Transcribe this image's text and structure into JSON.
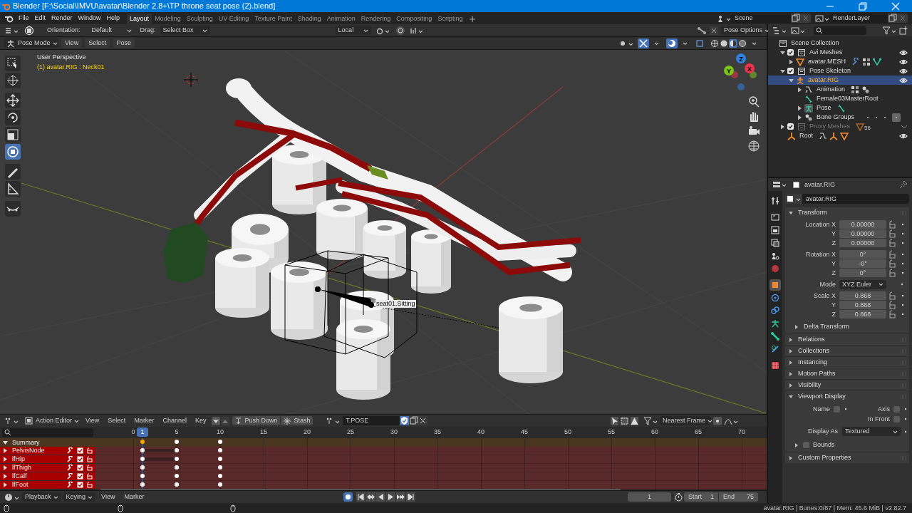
{
  "title_bar": {
    "title": "Blender [F:\\Social\\IMVU\\avatar\\Blender 2.8+\\TP throne seat pose (2).blend]"
  },
  "top_bar": {
    "menus": [
      "File",
      "Edit",
      "Render",
      "Window",
      "Help"
    ],
    "workspaces": [
      {
        "label": "Layout",
        "selected": true
      },
      {
        "label": "Modeling",
        "selected": false
      },
      {
        "label": "Sculpting",
        "selected": false
      },
      {
        "label": "UV Editing",
        "selected": false
      },
      {
        "label": "Texture Paint",
        "selected": false
      },
      {
        "label": "Shading",
        "selected": false
      },
      {
        "label": "Animation",
        "selected": false
      },
      {
        "label": "Rendering",
        "selected": false
      },
      {
        "label": "Compositing",
        "selected": false
      },
      {
        "label": "Scripting",
        "selected": false
      }
    ],
    "scene": "Scene",
    "view_layer": "RenderLayer"
  },
  "tool_settings": {
    "orientation_label": "Orientation:",
    "orientation": "Default",
    "drag_label": "Drag:",
    "drag": "Select Box",
    "pivot": "Local",
    "pose_options": "Pose Options"
  },
  "viewport_header": {
    "mode": "Pose Mode",
    "menus": [
      "View",
      "Select",
      "Pose"
    ],
    "shading": [
      {
        "kind": "wireframe",
        "selected": false
      },
      {
        "kind": "solid",
        "selected": false
      },
      {
        "kind": "material",
        "selected": true
      },
      {
        "kind": "rendered",
        "selected": false
      }
    ]
  },
  "viewport": {
    "view_name": "User Perspective",
    "active": "(1) avatar.RIG : Neck01",
    "bone_label": "seat01.Sitting",
    "tools": [
      {
        "kind": "select",
        "selected": false
      },
      {
        "kind": "cursor",
        "selected": false
      },
      {
        "kind": "move",
        "selected": false
      },
      {
        "kind": "rotate",
        "selected": false
      },
      {
        "kind": "scale",
        "selected": false
      },
      {
        "kind": "transform",
        "selected": true
      },
      {
        "kind": "annotate",
        "selected": false
      },
      {
        "kind": "measure",
        "selected": false
      },
      {
        "kind": "relax",
        "selected": false
      }
    ],
    "gizmo": [
      {
        "label": "Z",
        "color": "#2f7fe0"
      },
      {
        "label": "Y",
        "color": "#7cc41a"
      },
      {
        "label": "X",
        "color": "#e8344e"
      }
    ]
  },
  "outliner": {
    "items": [
      {
        "label": "Scene Collection",
        "kind": "scene_collection",
        "selected": false,
        "children": [
          {
            "label": "Avi Meshes",
            "kind": "collection",
            "checked": true,
            "expanded": true,
            "selected": false,
            "children": [
              {
                "label": "avatar.MESH",
                "kind": "mesh",
                "expanded": false,
                "selected": false
              }
            ]
          },
          {
            "label": "Pose Skeleton",
            "kind": "collection",
            "checked": true,
            "expanded": true,
            "selected": false,
            "children": [
              {
                "label": "avatar.RIG",
                "kind": "armature",
                "expanded": true,
                "selected": true,
                "children": [
                  {
                    "label": "Animation",
                    "kind": "animation",
                    "expanded": false,
                    "selected": false
                  },
                  {
                    "label": "Female03MasterRoot",
                    "kind": "bone",
                    "selected": false
                  },
                  {
                    "label": "Pose",
                    "kind": "pose",
                    "expanded": false,
                    "selected": false
                  },
                  {
                    "label": "Bone Groups",
                    "kind": "bone_groups",
                    "expanded": false,
                    "selected": false
                  }
                ]
              }
            ]
          },
          {
            "label": "Proxy Meshes",
            "kind": "collection",
            "checked": true,
            "expanded": false,
            "disabled": true,
            "badge": "56",
            "selected": false
          },
          {
            "label": "Root",
            "kind": "empty",
            "selected": false
          }
        ]
      }
    ]
  },
  "properties": {
    "title": "avatar.RIG",
    "object_name": "avatar.RIG",
    "tabs": [
      {
        "kind": "tool",
        "selected": false
      },
      {
        "kind": "render",
        "selected": false
      },
      {
        "kind": "output",
        "selected": false
      },
      {
        "kind": "view_layer",
        "selected": false
      },
      {
        "kind": "scene",
        "selected": false
      },
      {
        "kind": "world",
        "selected": false
      },
      {
        "kind": "object",
        "selected": true
      },
      {
        "kind": "physics",
        "selected": false
      },
      {
        "kind": "constraints",
        "selected": false
      },
      {
        "kind": "data",
        "selected": false
      },
      {
        "kind": "bone",
        "selected": false
      },
      {
        "kind": "bone_constraints",
        "selected": false
      },
      {
        "kind": "texture",
        "selected": false
      }
    ],
    "transform": {
      "title": "Transform",
      "expanded": true,
      "groups": [
        [
          {
            "label": "Location X",
            "value": "0.00000",
            "kind": "number"
          },
          {
            "label": "Y",
            "value": "0.00000",
            "kind": "number"
          },
          {
            "label": "Z",
            "value": "0.00000",
            "kind": "number"
          }
        ],
        [
          {
            "label": "Rotation X",
            "value": "0°",
            "kind": "number"
          },
          {
            "label": "Y",
            "value": "-0°",
            "kind": "number"
          },
          {
            "label": "Z",
            "value": "0°",
            "kind": "number"
          }
        ],
        [
          {
            "label": "Mode",
            "value": "XYZ Euler",
            "kind": "dropdown"
          }
        ],
        [
          {
            "label": "Scale X",
            "value": "0.868",
            "kind": "number"
          },
          {
            "label": "Y",
            "value": "0.868",
            "kind": "number"
          },
          {
            "label": "Z",
            "value": "0.868",
            "kind": "number"
          }
        ]
      ],
      "subpanel": {
        "title": "Delta Transform",
        "expanded": false
      }
    },
    "panels": [
      {
        "title": "Relations",
        "expanded": false
      },
      {
        "title": "Collections",
        "expanded": false
      },
      {
        "title": "Instancing",
        "expanded": false
      },
      {
        "title": "Motion Paths",
        "expanded": false
      },
      {
        "title": "Visibility",
        "expanded": false
      },
      {
        "title": "Viewport Display",
        "expanded": true,
        "options": [
          {
            "label": "Name",
            "checked": false
          },
          {
            "label": "Axis",
            "checked": false
          },
          {
            "label": "In Front",
            "checked": false
          }
        ],
        "display_as_label": "Display As",
        "display_as": "Textured",
        "bounds": {
          "label": "Bounds",
          "checked": false,
          "expanded": false
        }
      },
      {
        "title": "Custom Properties",
        "expanded": false
      }
    ]
  },
  "dopesheet": {
    "mode": "Action Editor",
    "menus": [
      "View",
      "Select",
      "Marker",
      "Channel",
      "Key"
    ],
    "push_down": "Push Down",
    "stash": "Stash",
    "action": "T.POSE",
    "snap": "Nearest Frame",
    "current_frame": "1",
    "ruler": [
      "0",
      "5",
      "10",
      "15",
      "20",
      "25",
      "30",
      "35",
      "40",
      "45",
      "50",
      "55",
      "60",
      "65",
      "70"
    ],
    "channels": [
      {
        "label": "Summary",
        "kind": "summary",
        "expanded": true
      },
      {
        "label": "PelvisNode",
        "kind": "group",
        "expanded": false
      },
      {
        "label": "lfHip",
        "kind": "group",
        "expanded": false
      },
      {
        "label": "lfThigh",
        "kind": "group",
        "expanded": false
      },
      {
        "label": "lfCalf",
        "kind": "group",
        "expanded": false
      },
      {
        "label": "lfFoot",
        "kind": "group",
        "expanded": false
      }
    ]
  },
  "timeline": {
    "menus": [
      "Playback",
      "Keying",
      "View",
      "Marker"
    ],
    "auto_keying": true,
    "current_frame": "1",
    "start_label": "Start",
    "start": "1",
    "end_label": "End",
    "end": "75"
  },
  "status_bar": {
    "text": "avatar.RIG | Bones:0/87 | Mem: 45.6 MiB | v2.82.7"
  }
}
